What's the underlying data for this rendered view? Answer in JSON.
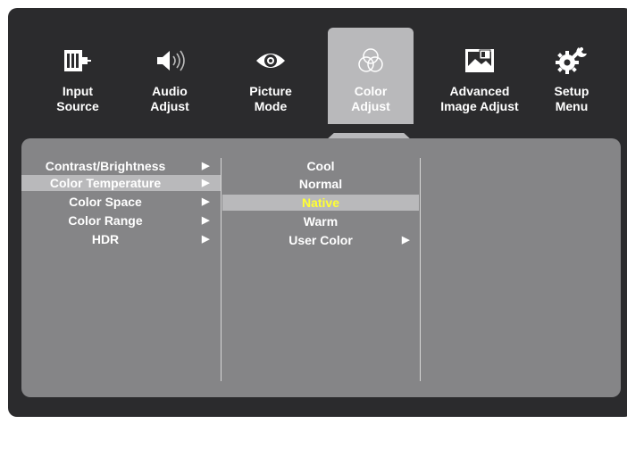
{
  "tabs": [
    {
      "line1": "Input",
      "line2": "Source",
      "icon": "input-source-icon"
    },
    {
      "line1": "Audio",
      "line2": "Adjust",
      "icon": "speaker-icon"
    },
    {
      "line1": "Picture",
      "line2": "Mode",
      "icon": "eye-icon"
    },
    {
      "line1": "Color",
      "line2": "Adjust",
      "icon": "color-circles-icon",
      "active": true
    },
    {
      "line1": "Advanced",
      "line2": "Image Adjust",
      "icon": "image-adjust-icon"
    },
    {
      "line1": "Setup",
      "line2": "Menu",
      "icon": "gear-wrench-icon"
    }
  ],
  "menu": {
    "items": [
      {
        "label": "Contrast/Brightness",
        "arrow": "▶"
      },
      {
        "label": "Color Temperature",
        "arrow": "▶",
        "selected": true
      },
      {
        "label": "Color Space",
        "arrow": "▶"
      },
      {
        "label": "Color Range",
        "arrow": "▶"
      },
      {
        "label": "HDR",
        "arrow": "▶"
      }
    ]
  },
  "submenu": {
    "items": [
      {
        "label": "Cool"
      },
      {
        "label": "Normal"
      },
      {
        "label": "Native",
        "selected": true
      },
      {
        "label": "Warm"
      },
      {
        "label": "User Color",
        "arrow": "▶"
      }
    ]
  },
  "colors": {
    "background": "#2b2b2d",
    "panel": "#858587",
    "highlight": "#b9b9bb",
    "selected_text": "#ffff33"
  }
}
